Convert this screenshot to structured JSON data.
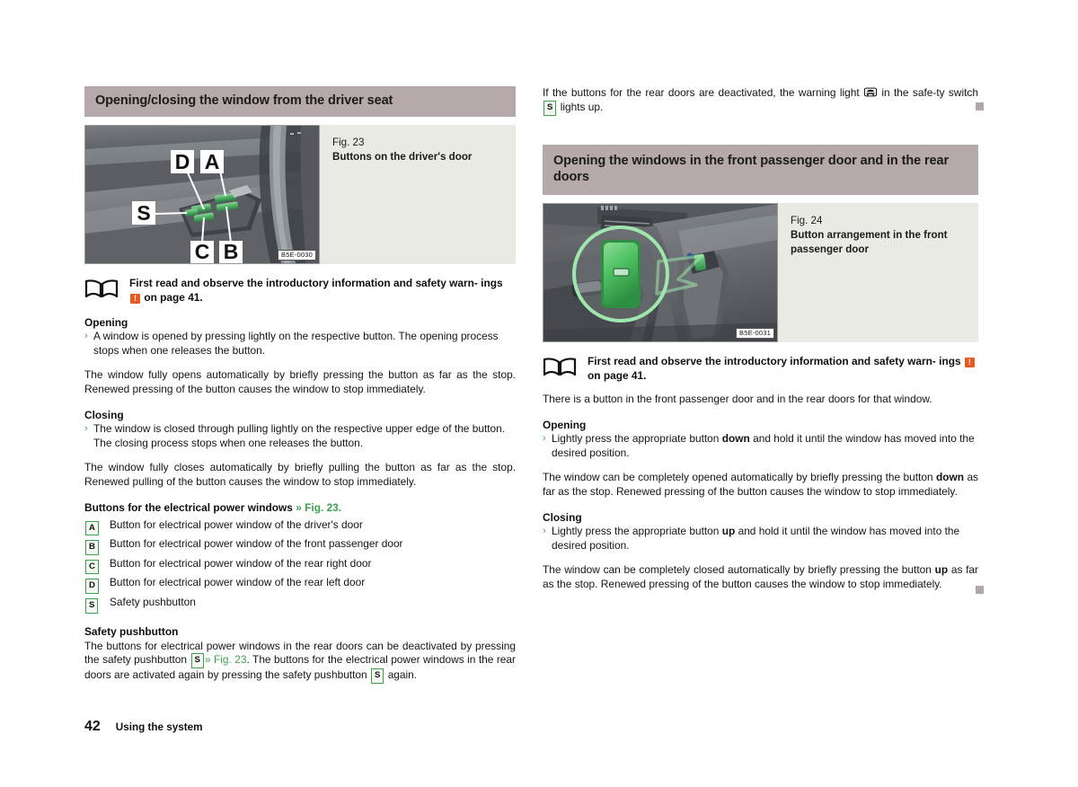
{
  "document": {
    "page_number": "42",
    "footer_section": "Using the system"
  },
  "left_column": {
    "section_heading": "Opening/closing the window from the driver seat",
    "figure": {
      "number": "Fig. 23",
      "title": "Buttons on the driver's door",
      "code": "B5E-0030",
      "callouts": [
        "D",
        "A",
        "S",
        "C",
        "B"
      ]
    },
    "note": {
      "icon": "book-icon",
      "text_part1": "First read and observe the introductory information and safety warn-",
      "text_part2": "ings",
      "warning_icon": "!",
      "text_part3": "on page 41."
    },
    "opening_heading": "Opening",
    "opening_bullet": "A window is opened by pressing lightly on the respective button. The opening process stops when one releases the button.",
    "opening_para": "The window fully opens automatically by briefly pressing the button as far as the stop. Renewed pressing of the button causes the window to stop immediately.",
    "closing_heading": "Closing",
    "closing_bullet": "The window is closed through pulling lightly on the respective upper edge of the button. The closing process stops when one releases the button.",
    "closing_para": "The window fully closes automatically by briefly pulling the button as far as the stop. Renewed pulling of the button causes the window to stop immediately.",
    "legend_heading": "Buttons for the electrical power windows",
    "legend_xref": "» Fig. 23.",
    "legend": [
      {
        "key": "A",
        "label": "Button for electrical power window of the driver's door"
      },
      {
        "key": "B",
        "label": "Button for electrical power window of the front passenger door"
      },
      {
        "key": "C",
        "label": "Button for electrical power window of the rear right door"
      },
      {
        "key": "D",
        "label": "Button for electrical power window of the rear left door"
      },
      {
        "key": "S",
        "label": "Safety pushbutton"
      }
    ],
    "safety_heading": "Safety pushbutton",
    "safety_text_1": "The buttons for electrical power windows in the rear doors can be deactivated by pressing the safety pushbutton",
    "safety_key_1": "S",
    "safety_xref": "» Fig. 23",
    "safety_text_2": ". The buttons for the electrical power windows in the rear doors are activated again by pressing the safety pushbutton",
    "safety_key_2": "S",
    "safety_text_3": "again."
  },
  "right_column": {
    "intro_text_1": "If the buttons for the rear doors are deactivated, the warning light",
    "intro_warning_icon": "window-warning-light-icon",
    "intro_text_2": "in the safe-ty switch",
    "intro_key": "S",
    "intro_text_3": "lights up.",
    "section_heading": "Opening the windows in the front passenger door and in the rear doors",
    "figure": {
      "number": "Fig. 24",
      "title_line1": "Button arrangement in the front",
      "title_line2": "passenger door",
      "code": "B5E-0031"
    },
    "note": {
      "icon": "book-icon",
      "text_part1": "First read and observe the introductory information and safety warn-",
      "text_part2": "ings",
      "warning_icon": "!",
      "text_part3": "on page 41."
    },
    "intro_para": "There is a button in the front passenger door and in the rear doors for that window.",
    "opening_heading": "Opening",
    "opening_bullet_a": "Lightly press the appropriate button",
    "opening_bullet_bold": "down",
    "opening_bullet_b": "and hold it until the window has moved into the desired position.",
    "opening_para_a": "The window can be completely opened automatically by briefly pressing the button",
    "opening_para_bold": "down",
    "opening_para_b": "as far as the stop. Renewed pressing of the button causes the window to stop immediately.",
    "closing_heading": "Closing",
    "closing_bullet_a": "Lightly press the appropriate button",
    "closing_bullet_bold": "up",
    "closing_bullet_b": "and hold it until the window has moved into the desired position.",
    "closing_para_a": "The window can be completely closed automatically by briefly pressing the button",
    "closing_para_bold": "up",
    "closing_para_b": "as far as the stop. Renewed pressing of the button causes the window to stop immediately."
  },
  "colors": {
    "section_bar": "#b5a9a9",
    "figure_panel": "#e9eae4",
    "accent_green": "#3f9e4d",
    "warning_orange": "#e8581f",
    "end_marker": "#b0a6ab"
  }
}
